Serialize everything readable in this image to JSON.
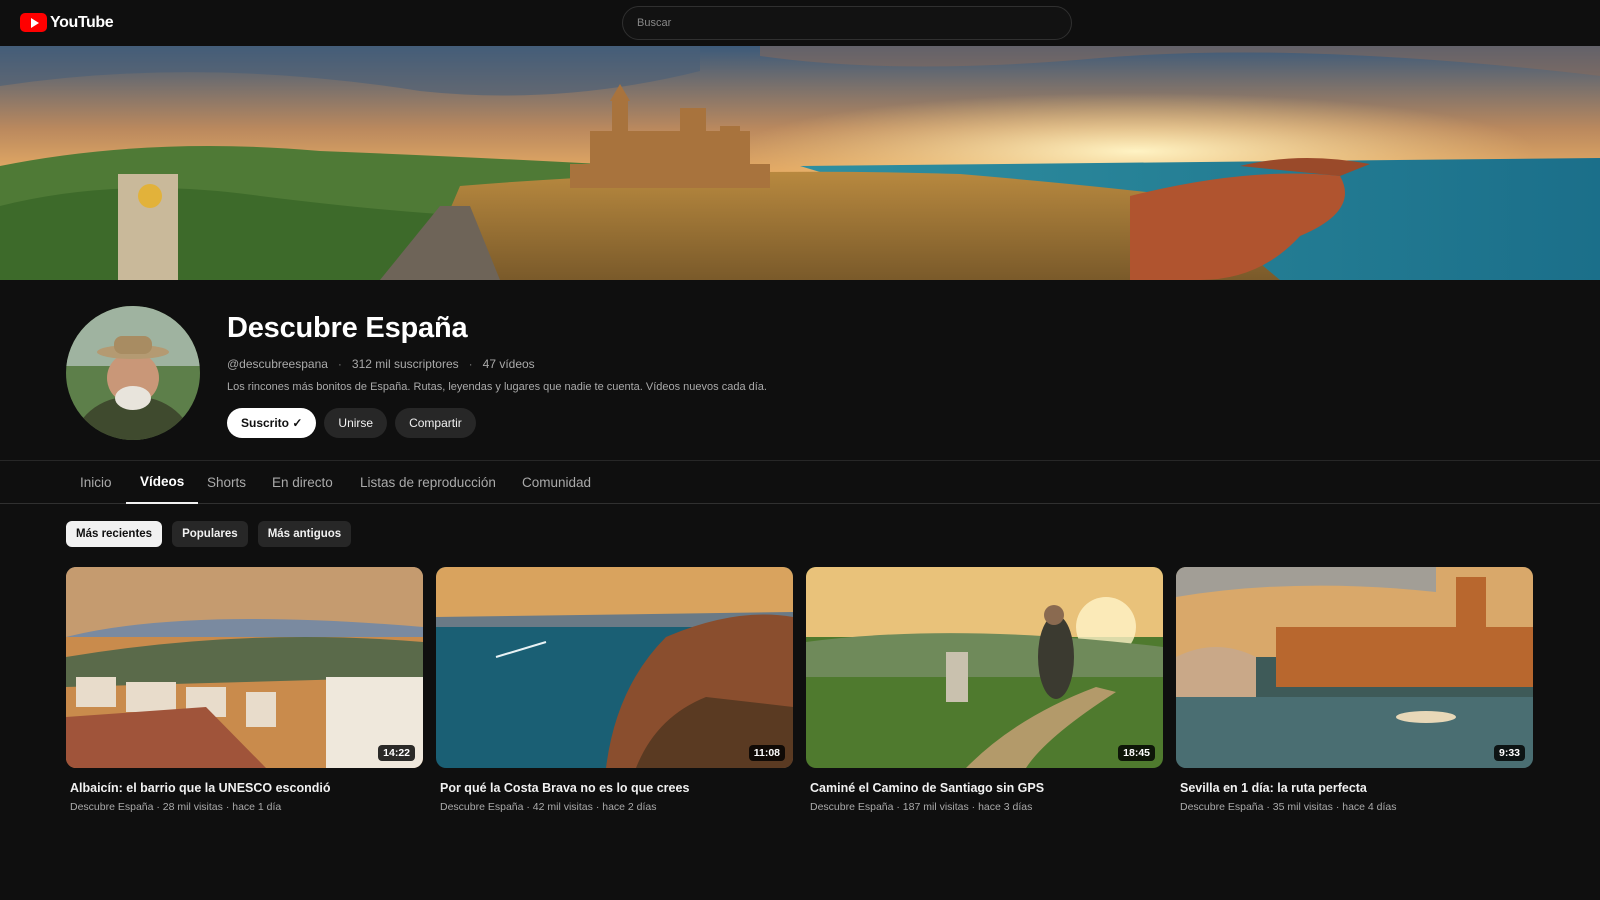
{
  "app": {
    "logo_text": "YouTube"
  },
  "search": {
    "placeholder": "Buscar"
  },
  "channel": {
    "name": "Descubre España",
    "handle": "@descubreespana",
    "subscribers": "312 mil suscriptores",
    "videos_count": "47 vídeos",
    "description": "Los rincones más bonitos de España. Rutas, leyendas y lugares que nadie te cuenta. Vídeos nuevos cada día.",
    "separator": "·",
    "actions": {
      "subscribed": "Suscrito ✓",
      "join": "Unirse",
      "share": "Compartir"
    }
  },
  "tabs": [
    "Inicio",
    "Vídeos",
    "Shorts",
    "En directo",
    "Listas de reproducción",
    "Comunidad"
  ],
  "active_tab": "Vídeos",
  "chips": [
    "Más recientes",
    "Populares",
    "Más antiguos"
  ],
  "active_chip": "Más recientes",
  "videos": [
    {
      "title": "Albaicín: el barrio que la UNESCO escondió",
      "meta": "Descubre España · 28 mil visitas · hace 1 día",
      "duration": "14:22"
    },
    {
      "title": "Por qué la Costa Brava no es lo que crees",
      "meta": "Descubre España · 42 mil visitas · hace 2 días",
      "duration": "11:08"
    },
    {
      "title": "Caminé el Camino de Santiago sin GPS",
      "meta": "Descubre España · 187 mil visitas · hace 3 días",
      "duration": "18:45"
    },
    {
      "title": "Sevilla en 1 día: la ruta perfecta",
      "meta": "Descubre España · 35 mil visitas · hace 4 días",
      "duration": "9:33"
    }
  ],
  "colors": {
    "background": "#0f0f0f",
    "brand_red": "#ff0000",
    "chip": "#272727",
    "text_secondary": "#aaaaaa"
  }
}
